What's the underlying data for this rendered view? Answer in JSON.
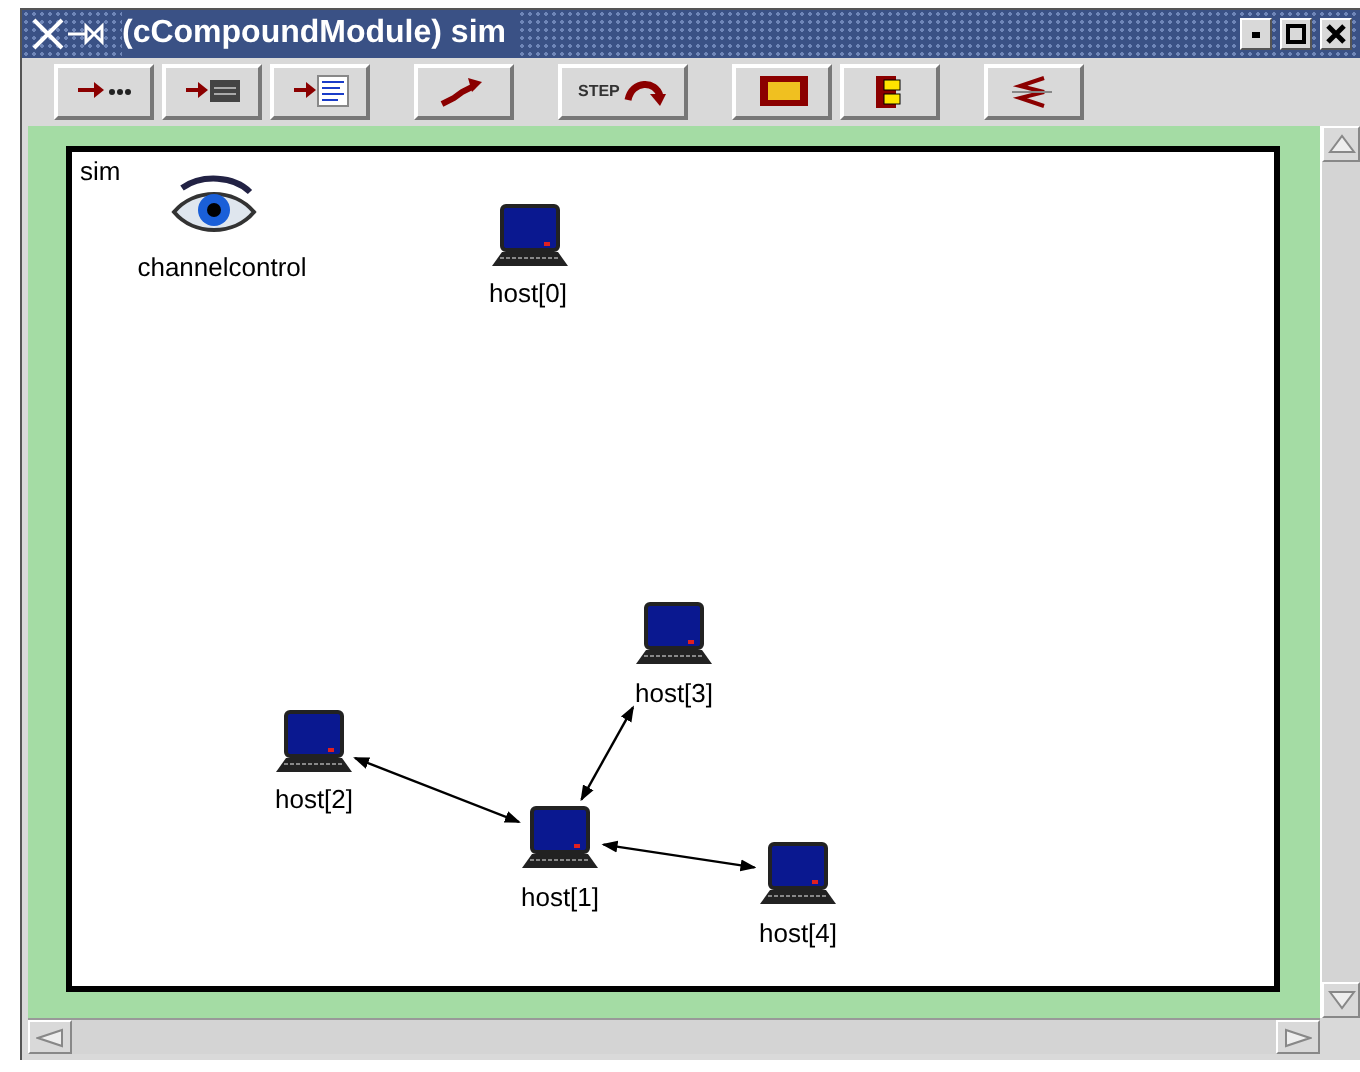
{
  "window": {
    "title": "(cCompoundModule) sim"
  },
  "toolbar_groups": [
    [
      {
        "kind": "run-arrow"
      },
      {
        "kind": "run-window"
      },
      {
        "kind": "run-list"
      }
    ],
    [
      {
        "kind": "stairs"
      }
    ],
    [
      {
        "kind": "step",
        "label": "STEP"
      }
    ],
    [
      {
        "kind": "params"
      },
      {
        "kind": "module"
      }
    ],
    [
      {
        "kind": "zigzag"
      }
    ]
  ],
  "canvas": {
    "module_label": "sim",
    "nodes": [
      {
        "kind": "eye",
        "label": "channelcontrol"
      },
      {
        "kind": "computer",
        "label": "host[0]"
      },
      {
        "kind": "computer",
        "label": "host[1]"
      },
      {
        "kind": "computer",
        "label": "host[2]"
      },
      {
        "kind": "computer",
        "label": "host[3]"
      },
      {
        "kind": "computer",
        "label": "host[4]"
      }
    ]
  }
}
